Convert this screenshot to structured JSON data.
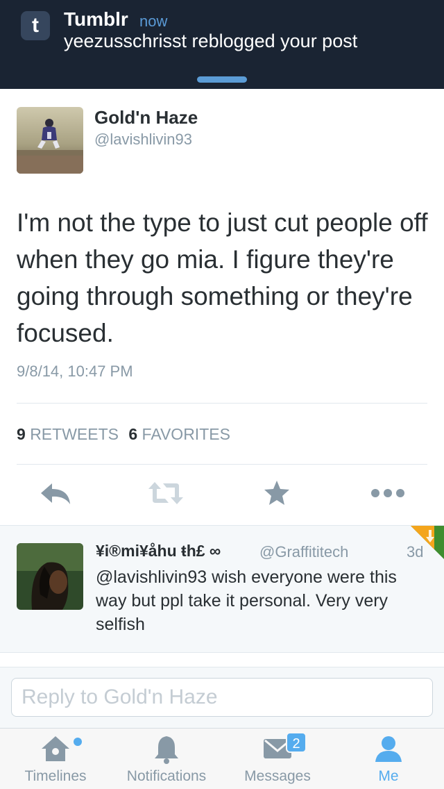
{
  "notification": {
    "app_name": "Tumblr",
    "app_icon_letter": "t",
    "time": "now",
    "message": "yeezusschrisst reblogged your post"
  },
  "tweet": {
    "author_name": "Gold'n Haze",
    "author_handle": "@lavishlivin93",
    "text": "I'm not the type to just cut people off when they go mia. I figure they're going through something or they're focused.",
    "timestamp": "9/8/14, 10:47 PM",
    "retweets_count": "9",
    "retweets_label": "RETWEETS",
    "favorites_count": "6",
    "favorites_label": "FAVORITES"
  },
  "actions": {
    "reply_icon": "reply-icon",
    "retweet_icon": "retweet-icon",
    "favorite_icon": "star-icon",
    "more_icon": "more-icon"
  },
  "reply": {
    "author_name": "¥i®mi¥åhu ŧh£ ∞",
    "author_handle": "@Graffititech",
    "time": "3d",
    "text": "@lavishlivin93 wish everyone were this way but ppl take it personal. Very very selfish"
  },
  "composer": {
    "placeholder": "Reply to Gold'n Haze"
  },
  "tabbar": {
    "tabs": [
      {
        "label": "Timelines",
        "icon": "home-icon"
      },
      {
        "label": "Notifications",
        "icon": "bell-icon"
      },
      {
        "label": "Messages",
        "icon": "messages-icon",
        "badge": "2"
      },
      {
        "label": "Me",
        "icon": "person-icon"
      }
    ]
  },
  "colors": {
    "accent": "#55acee",
    "icon_gray": "#8899a6",
    "banner_bg": "#1a2433"
  }
}
